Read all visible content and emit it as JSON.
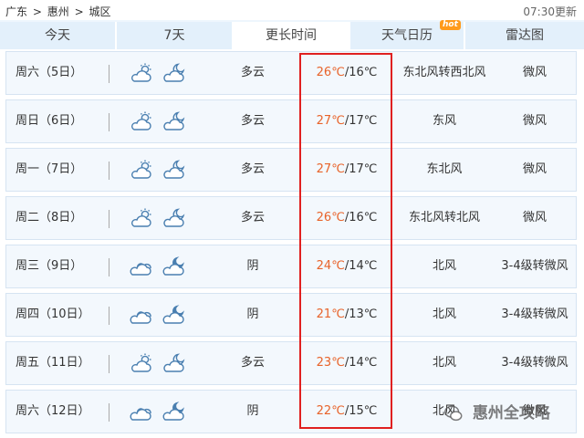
{
  "breadcrumb": {
    "province": "广东",
    "sep1": ">",
    "city": "惠州",
    "sep2": ">",
    "district": "城区"
  },
  "update_time": "07:30更新",
  "tabs": [
    {
      "label": "今天"
    },
    {
      "label": "7天"
    },
    {
      "label": "更长时间"
    },
    {
      "label": "天气日历",
      "badge": "hot"
    },
    {
      "label": "雷达图"
    }
  ],
  "active_tab": "更长时间",
  "forecast": [
    {
      "day": "周六（5日）",
      "icon_day": "partly-cloudy-sun-icon",
      "icon_night": "cloud-moon-icon",
      "desc": "多云",
      "high": "26℃",
      "low": "/16℃",
      "wind": "东北风转西北风",
      "level": "微风"
    },
    {
      "day": "周日（6日）",
      "icon_day": "partly-cloudy-sun-icon",
      "icon_night": "cloud-moon-icon",
      "desc": "多云",
      "high": "27℃",
      "low": "/17℃",
      "wind": "东风",
      "level": "微风"
    },
    {
      "day": "周一（7日）",
      "icon_day": "partly-cloudy-sun-icon",
      "icon_night": "cloud-moon-icon",
      "desc": "多云",
      "high": "27℃",
      "low": "/17℃",
      "wind": "东北风",
      "level": "微风"
    },
    {
      "day": "周二（8日）",
      "icon_day": "partly-cloudy-sun-icon",
      "icon_night": "cloud-moon-icon",
      "desc": "多云",
      "high": "26℃",
      "low": "/16℃",
      "wind": "东北风转北风",
      "level": "微风"
    },
    {
      "day": "周三（9日）",
      "icon_day": "cloudy-icon",
      "icon_night": "overcast-moon-icon",
      "desc": "阴",
      "high": "24℃",
      "low": "/14℃",
      "wind": "北风",
      "level": "3-4级转微风"
    },
    {
      "day": "周四（10日）",
      "icon_day": "cloudy-icon",
      "icon_night": "overcast-moon-icon",
      "desc": "阴",
      "high": "21℃",
      "low": "/13℃",
      "wind": "北风",
      "level": "3-4级转微风"
    },
    {
      "day": "周五（11日）",
      "icon_day": "partly-cloudy-sun-icon",
      "icon_night": "cloud-moon-icon",
      "desc": "多云",
      "high": "23℃",
      "low": "/14℃",
      "wind": "北风",
      "level": "3-4级转微风"
    },
    {
      "day": "周六（12日）",
      "icon_day": "cloudy-icon",
      "icon_night": "overcast-moon-icon",
      "desc": "阴",
      "high": "22℃",
      "low": "/15℃",
      "wind": "北风",
      "level": "微风"
    }
  ],
  "watermark": "惠州全攻略",
  "colors": {
    "high_temp": "#e8632a",
    "highlight_border": "#e02020",
    "tab_bg": "#e3f0fb",
    "row_bg": "#f3f8fd",
    "hot_badge": "#ff9a1a"
  }
}
